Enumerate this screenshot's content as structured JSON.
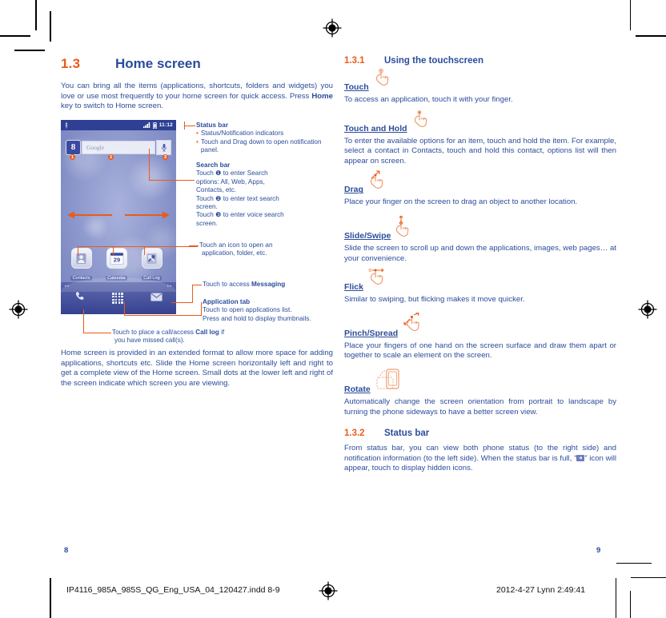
{
  "document": {
    "footer_file": "IP4116_985A_985S_QG_Eng_USA_04_120427.indd   8-9",
    "footer_date": "2012-4-27   Lynn 2:49:41",
    "page_left": "8",
    "page_right": "9"
  },
  "colors": {
    "heading_orange": "#ea5b1b",
    "heading_blue": "#2b4c9b",
    "body_blue": "#2b4c9b",
    "phone_statusbar": "#2f3f93",
    "leader_orange": "#ea5b1b"
  },
  "left_column": {
    "section": {
      "number": "1.3",
      "title": "Home screen"
    },
    "intro": "You can bring all the items (applications, shortcuts, folders and widgets) you love or use most frequently to your home screen for quick access. Press Home key to switch to Home screen.",
    "intro_bold": "Home",
    "outro": "Home screen is provided in an extended format to allow more space for adding applications, shortcuts etc. Slide the Home screen horizontally left and right to get a complete view of the Home screen. Small dots at the lower left and right of the screen indicate which screen you are viewing.",
    "phone": {
      "status_clock": "11:12",
      "status_icons": [
        "usb-icon",
        "signal-icon",
        "battery-icon"
      ],
      "search_logo": "8",
      "search_placeholder": "Google",
      "search_mic": "microphone-icon",
      "markers": [
        "1",
        "2",
        "3"
      ],
      "app_icons": [
        {
          "label": "Contacts",
          "icon": "contacts-icon"
        },
        {
          "label": "Calendar",
          "icon": "calendar-icon",
          "day": "29"
        },
        {
          "label": "Call Log",
          "icon": "call-log-icon"
        }
      ],
      "dock": [
        {
          "name": "phone-icon"
        },
        {
          "name": "application-tab-icon"
        },
        {
          "name": "messaging-icon"
        }
      ],
      "page_dots_left": "••",
      "page_dots_right": "••"
    },
    "callouts": {
      "status_bar": {
        "title": "Status bar",
        "items": [
          "Status/Notification indicators",
          "Touch and Drag down to open notification panel."
        ]
      },
      "search_bar": {
        "title": "Search bar",
        "lines": [
          "Touch ❶ to enter Search",
          "options: All, Web, Apps,",
          "Contacts, etc.",
          "Touch ❷ to enter text search",
          "screen.",
          "Touch ❸ to enter voice search",
          "screen."
        ]
      },
      "open_app": [
        "Touch an icon to open an",
        "application, folder, etc."
      ],
      "messaging": {
        "prefix": "Touch to access ",
        "bold": "Messaging"
      },
      "application_tab": {
        "title": "Application tab",
        "lines": [
          "Touch to open applications list.",
          "Press and hold to display thumbnails."
        ]
      },
      "call_log": {
        "line1_pre": "Touch to place a call/access ",
        "line1_bold": "Call log",
        "line1_post": " if",
        "line2": "you have missed call(s)."
      }
    }
  },
  "right_column": {
    "section_touchscreen": {
      "number": "1.3.1",
      "title": "Using the touchscreen"
    },
    "gestures": [
      {
        "name": "Touch",
        "icon": "touch-hand-icon",
        "text": "To access an application, touch it with your finger."
      },
      {
        "name": "Touch and Hold",
        "icon": "touch-hold-hand-icon",
        "text": "To enter the available options for an item, touch and hold the item. For example, select a contact in Contacts, touch and hold this contact, options list will then appear on screen."
      },
      {
        "name": "Drag",
        "icon": "drag-hand-icon",
        "text": "Place your finger on the screen to drag an object to another location."
      },
      {
        "name": "Slide/Swipe",
        "icon": "slide-hand-icon",
        "text": "Slide the screen to scroll up and down the applications, images, web pages… at your convenience."
      },
      {
        "name": "Flick",
        "icon": "flick-hand-icon",
        "text": "Similar to swiping, but flicking makes it move quicker."
      },
      {
        "name": "Pinch/Spread",
        "icon": "pinch-spread-hand-icon",
        "text": "Place your fingers of one hand on the screen surface and draw them apart or together to scale an element on the screen."
      },
      {
        "name": "Rotate",
        "icon": "rotate-phone-icon",
        "text": "Automatically change the screen orientation from portrait to landscape by turning the phone sideways to have a better screen view."
      }
    ],
    "section_statusbar": {
      "number": "1.3.2",
      "title": "Status bar"
    },
    "statusbar_text_pre": "From status bar, you can view both phone status (to the right side) and notification information (to the left side). When the status bar is full, “",
    "statusbar_text_post": "”  icon will appear, touch to display hidden icons."
  }
}
